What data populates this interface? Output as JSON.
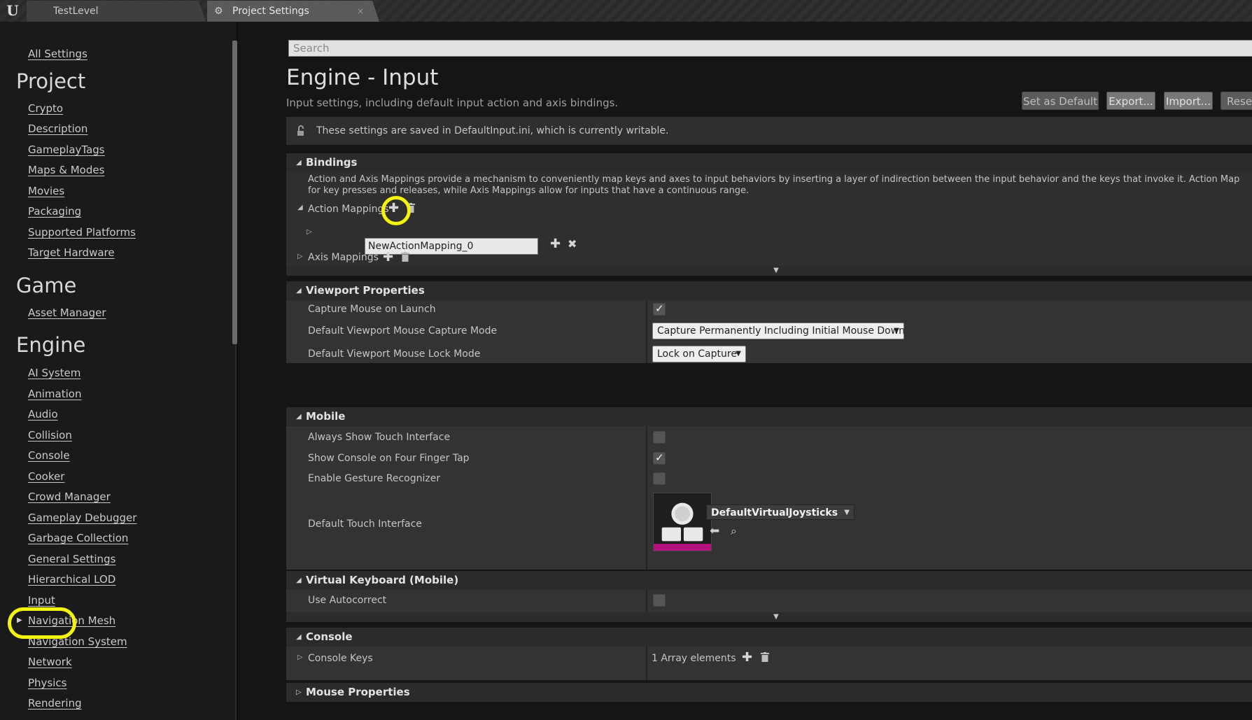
{
  "tabs": [
    {
      "label": "TestLevel"
    },
    {
      "label": "Project Settings",
      "close": "×"
    }
  ],
  "sidebar": {
    "all_settings": "All Settings",
    "project_heading": "Project",
    "project_items": [
      "Crypto",
      "Description",
      "GameplayTags",
      "Maps & Modes",
      "Movies",
      "Packaging",
      "Supported Platforms",
      "Target Hardware"
    ],
    "game_heading": "Game",
    "game_items": [
      "Asset Manager"
    ],
    "engine_heading": "Engine",
    "engine_items": [
      "AI System",
      "Animation",
      "Audio",
      "Collision",
      "Console",
      "Cooker",
      "Crowd Manager",
      "Gameplay Debugger",
      "Garbage Collection",
      "General Settings",
      "Hierarchical LOD",
      "Input",
      "Navigation Mesh",
      "Navigation System",
      "Network",
      "Physics",
      "Rendering"
    ],
    "selected": "Input"
  },
  "main": {
    "search_placeholder": "Search",
    "title": "Engine - Input",
    "description": "Input settings, including default input action and axis bindings.",
    "buttons": {
      "set_default": "Set as Default",
      "export": "Export...",
      "import": "Import...",
      "reset": "Reset"
    },
    "notice": "These settings are saved in DefaultInput.ini, which is currently writable."
  },
  "bindings": {
    "heading": "Bindings",
    "description_line1": "Action and Axis Mappings provide a mechanism to conveniently map keys and axes to input behaviors by inserting a layer of indirection between the input behavior and the keys that invoke it. Action Map",
    "description_line2": "for key presses and releases, while Axis Mappings allow for inputs that have a continuous range.",
    "action_mappings_label": "Action Mappings",
    "action_mapping_value": "NewActionMapping_0",
    "axis_mappings_label": "Axis Mappings"
  },
  "viewport": {
    "heading": "Viewport Properties",
    "rows": [
      {
        "label": "Capture Mouse on Launch",
        "checked": true
      },
      {
        "label": "Default Viewport Mouse Capture Mode",
        "value": "Capture Permanently Including Initial Mouse Down"
      },
      {
        "label": "Default Viewport Mouse Lock Mode",
        "value": "Lock on Capture"
      }
    ]
  },
  "mobile": {
    "heading": "Mobile",
    "rows": [
      {
        "label": "Always Show Touch Interface",
        "checked": false
      },
      {
        "label": "Show Console on Four Finger Tap",
        "checked": true
      },
      {
        "label": "Enable Gesture Recognizer",
        "checked": false
      },
      {
        "label": "Default Touch Interface",
        "value": "DefaultVirtualJoysticks"
      }
    ]
  },
  "virtual_keyboard": {
    "heading": "Virtual Keyboard (Mobile)",
    "rows": [
      {
        "label": "Use Autocorrect",
        "checked": false
      }
    ]
  },
  "console": {
    "heading": "Console",
    "keys_label": "Console Keys",
    "keys_value": "1 Array elements"
  },
  "mouse": {
    "heading": "Mouse Properties"
  },
  "colors": {
    "highlight": "#f4f210",
    "thumbnail_accent": "#b3127f"
  }
}
